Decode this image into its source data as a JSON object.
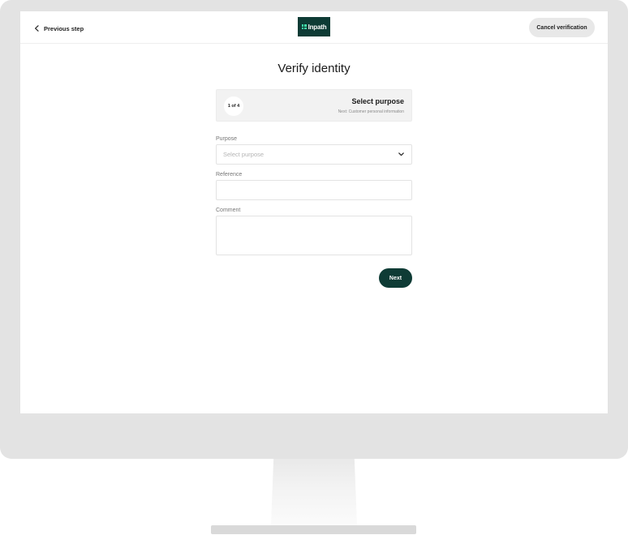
{
  "header": {
    "back_label": "Previous step",
    "logo_text": "Inpath",
    "cancel_label": "Cancel verification"
  },
  "main": {
    "title": "Verify identity",
    "step": {
      "count": "1 of 4",
      "title": "Select purpose",
      "next": "Next: Customer personal information"
    },
    "fields": {
      "purpose_label": "Purpose",
      "purpose_placeholder": "Select purpose",
      "reference_label": "Reference",
      "comment_label": "Comment"
    },
    "next_label": "Next"
  },
  "colors": {
    "brand_dark": "#0e3b35",
    "brand_accent": "#3fe0a8",
    "monitor_frame": "#e3e3e3"
  },
  "icons": [
    "chevron-left-icon",
    "chevron-down-icon",
    "inpath-logo-mark"
  ]
}
